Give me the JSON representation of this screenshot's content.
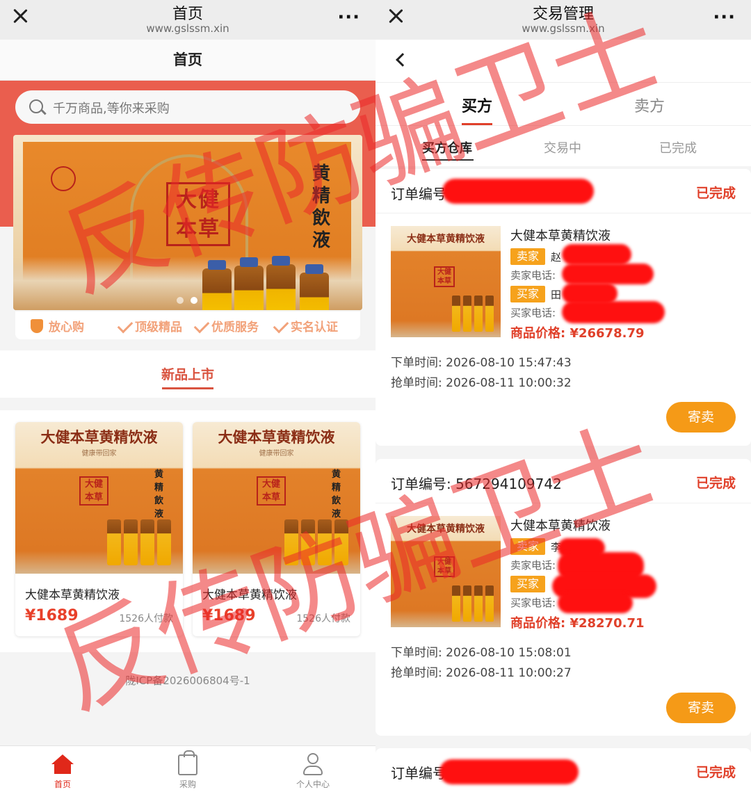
{
  "left": {
    "titlebar": {
      "title": "首页",
      "url": "www.gslssm.xin"
    },
    "header_title": "首页",
    "search": {
      "placeholder": "千万商品,等你来采购"
    },
    "banner": {
      "stamp_text": "大健\n本草",
      "vertical_text": "黄精飲液"
    },
    "badges": [
      "放心购",
      "顶级精品",
      "优质服务",
      "实名认证"
    ],
    "section_title": "新品上市",
    "products": [
      {
        "banner_title": "大健本草黄精饮液",
        "banner_sub": "健康带回家",
        "name": "大健本草黄精饮液",
        "price": "¥1689",
        "sold": "1526人付款"
      },
      {
        "banner_title": "大健本草黄精饮液",
        "banner_sub": "健康带回家",
        "name": "大健本草黄精饮液",
        "price": "¥1689",
        "sold": "1526人付款"
      }
    ],
    "icp": "陇ICP备2026006804号-1",
    "tabbar": [
      {
        "label": "首页",
        "icon": "home-icon",
        "active": true
      },
      {
        "label": "采购",
        "icon": "shopping-bag-icon",
        "active": false
      },
      {
        "label": "个人中心",
        "icon": "user-icon",
        "active": false
      }
    ],
    "accent_color": "#ea5e4e"
  },
  "right": {
    "titlebar": {
      "title": "交易管理",
      "url": "www.gslssm.xin"
    },
    "main_tabs": [
      "买方",
      "卖方"
    ],
    "sub_tabs": [
      "买方仓库",
      "交易中",
      "已完成"
    ],
    "orders": [
      {
        "order_label": "订单编号",
        "status": "已完成",
        "product_name": "大健本草黄精饮液",
        "img_title": "大健本草黄精饮液",
        "seller_tag": "卖家",
        "seller_name": "赵",
        "seller_phone": "卖家电话:",
        "buyer_tag": "买家",
        "buyer_name": "田",
        "buyer_phone": "买家电话:",
        "price": "商品价格: ¥26678.79",
        "order_time": "下单时间: 2026-08-10 15:47:43",
        "grab_time": "抢单时间: 2026-08-11 10:00:32",
        "button": "寄卖"
      },
      {
        "order_label": "订单编号: 567294109742",
        "status": "已完成",
        "product_name": "大健本草黄精饮液",
        "img_title": "大健本草黄精饮液",
        "seller_tag": "卖家",
        "seller_name": "李",
        "seller_phone": "卖家电话:",
        "buyer_tag": "买家",
        "buyer_name": "",
        "buyer_phone": "买家电话:",
        "price": "商品价格: ¥28270.71",
        "order_time": "下单时间: 2026-08-10 15:08:01",
        "grab_time": "抢单时间: 2026-08-11 10:00:27",
        "button": "寄卖"
      },
      {
        "order_label": "订单编号",
        "status": "已完成"
      }
    ],
    "accent_color": "#f59a17"
  },
  "watermark": "反传防骗卫士"
}
